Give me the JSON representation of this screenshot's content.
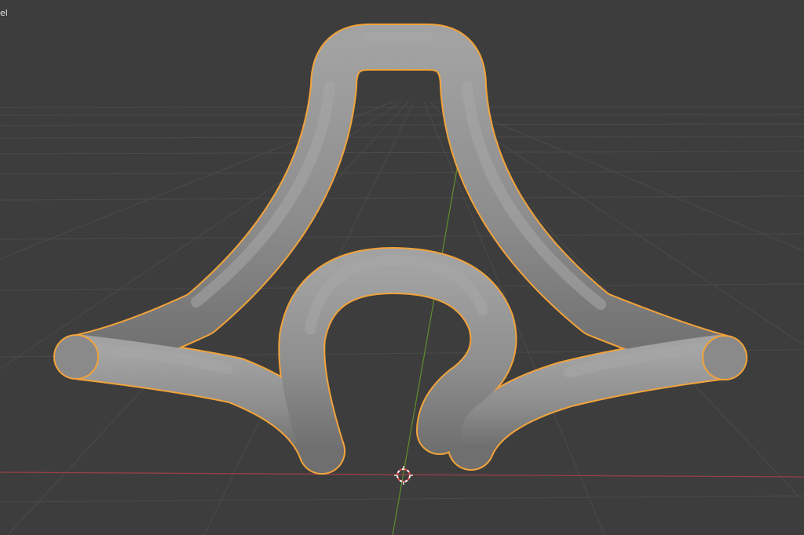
{
  "viewport": {
    "corner_label": "el",
    "colors": {
      "background": "#3d3d3d",
      "grid": "#4b4b4b",
      "x_axis": "#9b3f49",
      "y_axis": "#5f8f2b",
      "selection_outline": "#f2a33a",
      "mesh": "#8e8e8e"
    },
    "scene": {
      "object": "sculpted-tube-mesh",
      "selected": true,
      "cursor": "3d-cursor-icon"
    }
  }
}
